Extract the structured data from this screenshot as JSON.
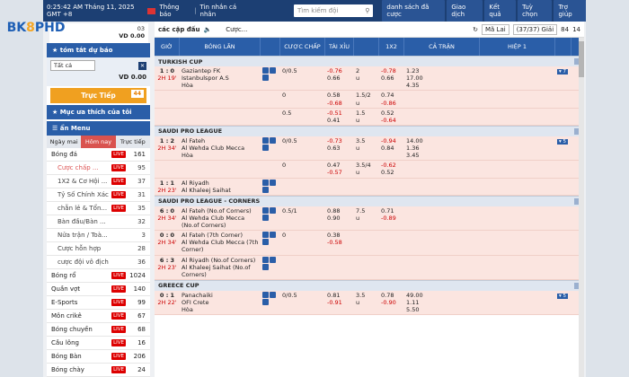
{
  "header": {
    "time": "0:25:42 AM Tháng 11, 2025 GMT +8",
    "notice": "Thông báo",
    "messages": "Tin nhắn cá nhân",
    "search_placeholder": "Tìm kiếm đội",
    "search_icon": "search-icon",
    "menu": [
      "danh sách đã cược",
      "Giao dịch",
      "Kết quả",
      "Tuỳ chọn",
      "Trợ giúp"
    ]
  },
  "brand": {
    "logo_main": "BK",
    "logo_accent": "8",
    "logo_tail": "PHD"
  },
  "user": {
    "id": "03",
    "balance": "VD 0.00"
  },
  "sidebar": {
    "summary": "tóm tắt dự báo",
    "select": "Tất cả",
    "balance": "VD 0.00",
    "live": "Trực Tiếp",
    "live_count": "44",
    "favorite": "Mục ưa thích của tôi",
    "menu_title": "ẩn Menu",
    "tabs": [
      "Ngày mai",
      "Hôm nay",
      "Trực tiếp"
    ],
    "sports": [
      {
        "name": "Bóng đá",
        "live": "LIVE",
        "count": "161"
      },
      {
        "name": "Cược chấp ...",
        "live": "LIVE",
        "count": "95",
        "sub": true,
        "hl": true
      },
      {
        "name": "1X2 & Cơ Hội ...",
        "live": "LIVE",
        "count": "37",
        "sub": true
      },
      {
        "name": "Tỷ Số Chính Xác",
        "live": "LIVE",
        "count": "31",
        "sub": true
      },
      {
        "name": "chẵn lẻ & Tổn...",
        "live": "LIVE",
        "count": "35",
        "sub": true
      },
      {
        "name": "Bàn đầu/Bàn ...",
        "live": "",
        "count": "32",
        "sub": true
      },
      {
        "name": "Nửa trận / Toà...",
        "live": "",
        "count": "3",
        "sub": true
      },
      {
        "name": "Cược hỗn hợp",
        "live": "",
        "count": "28",
        "sub": true
      },
      {
        "name": "cược đội vô địch",
        "live": "",
        "count": "36",
        "sub": true
      },
      {
        "name": "Bóng rổ",
        "live": "LIVE",
        "count": "1024"
      },
      {
        "name": "Quần vợt",
        "live": "LIVE",
        "count": "140"
      },
      {
        "name": "E-Sports",
        "live": "LIVE",
        "count": "99"
      },
      {
        "name": "Môn crikê",
        "live": "LIVE",
        "count": "67"
      },
      {
        "name": "Bóng chuyền",
        "live": "LIVE",
        "count": "68"
      },
      {
        "name": "Cầu lông",
        "live": "LIVE",
        "count": "16"
      },
      {
        "name": "Bóng Bàn",
        "live": "LIVE",
        "count": "206"
      },
      {
        "name": "Bóng chày",
        "live": "LIVE",
        "count": "24"
      }
    ]
  },
  "main": {
    "title": "các cặp đấu",
    "bet": "Cược...",
    "filter": "Mã Lai",
    "pages": "(37/37) Giải",
    "c1": "84",
    "c2": "14",
    "cols": [
      "GIỜ",
      "BÓNG LĂN",
      "CẢ TRẬN",
      "CƯỢC CHẤP",
      "TÀI XỈU",
      "1X2",
      "HIỆP 1",
      "CƯỢC CHẤP"
    ],
    "leagues": [
      {
        "name": "TURKISH CUP",
        "rows": [
          {
            "score": "1 : 0",
            "time": "2H 19'",
            "t1": "Gaziantep FK",
            "t2": "Istanbulspor A.S",
            "t3": "Hòa",
            "hc": "0/0.5",
            "h1": "-0.76",
            "h2": "0.66",
            "ou": "2",
            "ou2": "u",
            "o1": "-0.78",
            "o2": "0.66",
            "x1": "1.23",
            "x2": "17.00",
            "x3": "4.35",
            "more": "7"
          },
          {
            "score": "",
            "time": "",
            "t1": "",
            "t2": "",
            "t3": "",
            "hc": "0",
            "h1": "0.58",
            "h2": "-0.68",
            "ou": "1.5/2",
            "ou2": "u",
            "o1": "0.74",
            "o2": "-0.86",
            "x1": "",
            "x2": "",
            "x3": "",
            "more": ""
          },
          {
            "score": "",
            "time": "",
            "t1": "",
            "t2": "",
            "t3": "",
            "hc": "0.5",
            "h1": "-0.51",
            "h2": "0.41",
            "ou": "1.5",
            "ou2": "u",
            "o1": "0.52",
            "o2": "-0.64",
            "x1": "",
            "x2": "",
            "x3": "",
            "more": ""
          }
        ]
      },
      {
        "name": "SAUDI PRO LEAGUE",
        "rows": [
          {
            "score": "1 : 2",
            "time": "2H 34'",
            "t1": "Al Fateh",
            "t2": "Al Wehda Club Mecca",
            "t3": "Hòa",
            "hc": "0/0.5",
            "h1": "-0.73",
            "h2": "0.63",
            "ou": "3.5",
            "ou2": "u",
            "o1": "-0.94",
            "o2": "0.84",
            "x1": "14.00",
            "x2": "1.36",
            "x3": "3.45",
            "more": "5"
          },
          {
            "score": "",
            "time": "",
            "t1": "",
            "t2": "",
            "t3": "",
            "hc": "0",
            "h1": "0.47",
            "h2": "-0.57",
            "ou": "3.5/4",
            "ou2": "u",
            "o1": "-0.62",
            "o2": "0.52",
            "x1": "",
            "x2": "",
            "x3": "",
            "more": ""
          },
          {
            "score": "1 : 1",
            "time": "2H 23'",
            "t1": "Al Riyadh",
            "t2": "Al Khaleej Saihat",
            "t3": "",
            "hc": "",
            "h1": "",
            "h2": "",
            "ou": "",
            "ou2": "",
            "o1": "",
            "o2": "",
            "x1": "",
            "x2": "",
            "x3": "",
            "more": ""
          }
        ]
      },
      {
        "name": "SAUDI PRO LEAGUE - CORNERS",
        "rows": [
          {
            "score": "6 : 0",
            "time": "2H 34'",
            "t1": "Al Fateh (No.of Corners)",
            "t2": "Al Wehda Club Mecca (No.of Corners)",
            "t3": "",
            "hc": "0.5/1",
            "h1": "0.88",
            "h2": "0.90",
            "ou": "7.5",
            "ou2": "u",
            "o1": "0.71",
            "o2": "-0.89",
            "x1": "",
            "x2": "",
            "x3": "",
            "more": ""
          },
          {
            "score": "0 : 0",
            "time": "2H 34'",
            "t1": "Al Fateh (7th Corner)",
            "t2": "Al Wehda Club Mecca (7th Corner)",
            "t3": "",
            "hc": "0",
            "h1": "0.38",
            "h2": "-0.58",
            "ou": "",
            "ou2": "",
            "o1": "",
            "o2": "",
            "x1": "",
            "x2": "",
            "x3": "",
            "more": ""
          },
          {
            "score": "6 : 3",
            "time": "2H 23'",
            "t1": "Al Riyadh (No.of Corners)",
            "t2": "Al Khaleej Saihat (No.of Corners)",
            "t3": "",
            "hc": "",
            "h1": "",
            "h2": "",
            "ou": "",
            "ou2": "",
            "o1": "",
            "o2": "",
            "x1": "",
            "x2": "",
            "x3": "",
            "more": ""
          }
        ]
      },
      {
        "name": "GREECE CUP",
        "rows": [
          {
            "score": "0 : 1",
            "time": "2H 22'",
            "t1": "Panachaiki",
            "t2": "OFI Crete",
            "t3": "Hòa",
            "hc": "0/0.5",
            "h1": "0.81",
            "h2": "-0.91",
            "ou": "3.5",
            "ou2": "u",
            "o1": "0.78",
            "o2": "-0.90",
            "x1": "49.00",
            "x2": "1.11",
            "x3": "5.50",
            "more": "5"
          }
        ]
      }
    ]
  }
}
